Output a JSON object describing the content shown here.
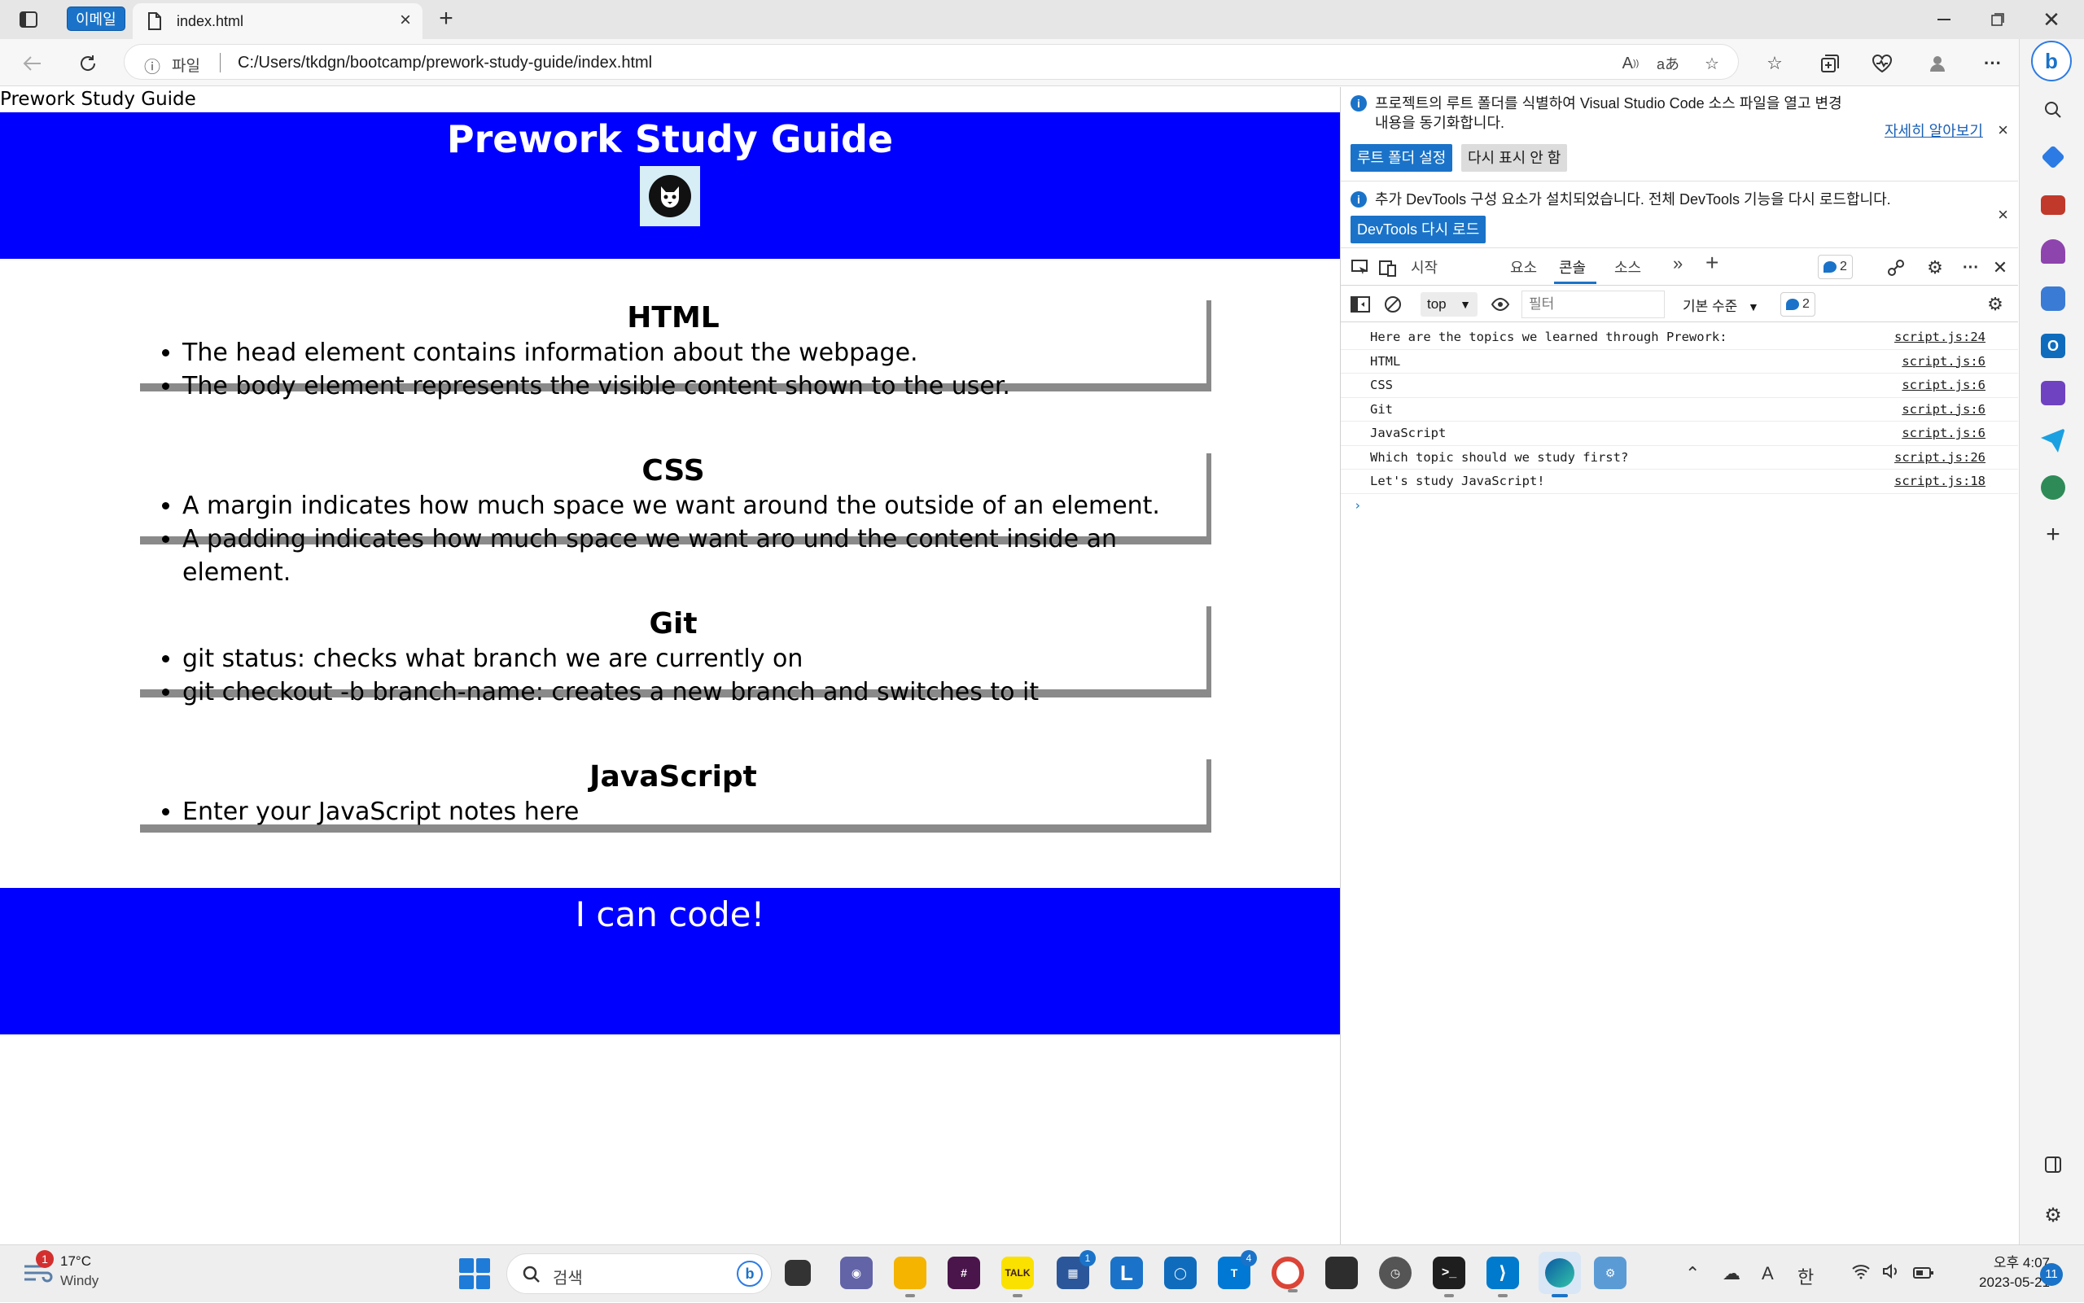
{
  "browser": {
    "workspace_label": "이메일",
    "tab_title": "index.html",
    "address_scheme_label": "파일",
    "address_url": "C:/Users/tkdgn/bootcamp/prework-study-guide/index.html"
  },
  "page": {
    "document_title": "Prework Study Guide",
    "header_title": "Prework Study Guide",
    "sections": [
      {
        "title": "HTML",
        "items": [
          "The head element contains information about the webpage.",
          "The body element represents the visible content shown to the user."
        ]
      },
      {
        "title": "CSS",
        "items": [
          "A margin indicates how much space we want around the outside of an element.",
          "A padding indicates how much space we want aro und the content inside an element."
        ]
      },
      {
        "title": "Git",
        "items": [
          "git status: checks what branch we are currently on",
          "git checkout -b branch-name: creates a new branch and switches to it"
        ]
      },
      {
        "title": "JavaScript",
        "items": [
          "Enter your JavaScript notes here"
        ]
      }
    ],
    "footer_text": "I can code!"
  },
  "devtools": {
    "info1": {
      "text_line1": "프로젝트의 루트 폴더를 식별하여 Visual Studio Code 소스 파일을 열고 변경",
      "text_line2": "내용을 동기화합니다.",
      "learn_more": "자세히 알아보기",
      "set_root_button": "루트 폴더 설정",
      "dont_show_button": "다시 표시 안 함"
    },
    "info2": {
      "text": "추가 DevTools 구성 요소가 설치되었습니다. 전체 DevTools 기능을 다시 로드합니다.",
      "reload_button": "DevTools 다시 로드"
    },
    "tabs": [
      "시작",
      "요소",
      "콘솔",
      "소스"
    ],
    "issues_count": "2",
    "context": "top",
    "filter_placeholder": "필터",
    "level_label": "기본 수준",
    "log_count": "2",
    "console_rows": [
      {
        "msg": "Here are the topics we learned through Prework:",
        "src": "script.js:24"
      },
      {
        "msg": "HTML",
        "src": "script.js:6"
      },
      {
        "msg": "CSS",
        "src": "script.js:6"
      },
      {
        "msg": "Git",
        "src": "script.js:6"
      },
      {
        "msg": "JavaScript",
        "src": "script.js:6"
      },
      {
        "msg": "Which topic should we study first?",
        "src": "script.js:26"
      },
      {
        "msg": "Let's study JavaScript!",
        "src": "script.js:18"
      }
    ]
  },
  "taskbar": {
    "weather_temp": "17°C",
    "weather_cond": "Windy",
    "weather_badge": "1",
    "search_label": "검색",
    "store_badge": "1",
    "teams_badge": "4",
    "ime_a": "A",
    "ime_lang": "한",
    "clock_time": "오후 4:07",
    "clock_date": "2023-05-21",
    "notif_count": "11"
  }
}
